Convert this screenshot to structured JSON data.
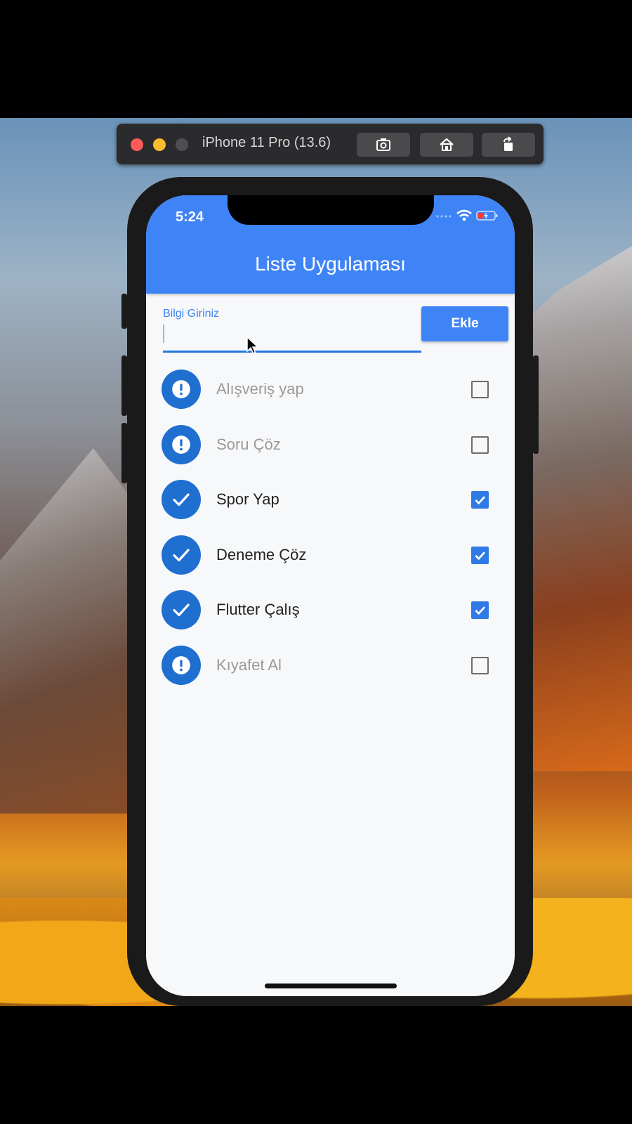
{
  "simulator": {
    "title": "iPhone 11 Pro (13.6)",
    "buttons": [
      "screenshot-icon",
      "home-icon",
      "rotate-icon"
    ]
  },
  "status_bar": {
    "time": "5:24",
    "icons": [
      "signal-dots-icon",
      "wifi-icon",
      "battery-charging-icon"
    ]
  },
  "app": {
    "title": "Liste Uygulaması",
    "accent_color": "#3f84f7"
  },
  "form": {
    "label": "Bilgi Giriniz",
    "value": "",
    "add_label": "Ekle"
  },
  "todos": [
    {
      "label": "Alışveriş yap",
      "done": false,
      "icon": "exclamation-icon"
    },
    {
      "label": "Soru Çöz",
      "done": false,
      "icon": "exclamation-icon"
    },
    {
      "label": "Spor Yap",
      "done": true,
      "icon": "check-icon"
    },
    {
      "label": "Deneme Çöz",
      "done": true,
      "icon": "check-icon"
    },
    {
      "label": "Flutter Çalış",
      "done": true,
      "icon": "check-icon"
    },
    {
      "label": "Kıyafet Al",
      "done": false,
      "icon": "exclamation-icon"
    }
  ]
}
